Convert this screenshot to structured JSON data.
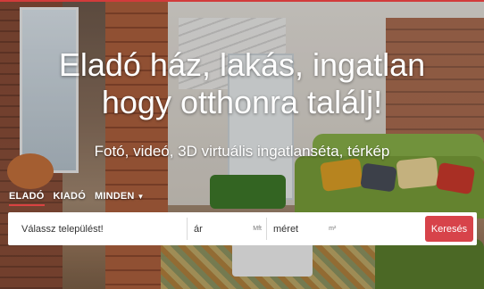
{
  "hero": {
    "headline_line1": "Eladó ház, lakás, ingatlan",
    "headline_line2": "hogy otthonra találj!",
    "subline": "Fotó, videó, 3D virtuális ingatlanséta, térkép"
  },
  "tabs": [
    {
      "label": "ELADÓ",
      "active": true
    },
    {
      "label": "KIADÓ",
      "active": false
    },
    {
      "label": "MINDEN",
      "active": false,
      "has_dropdown": true
    }
  ],
  "search": {
    "settlement_placeholder": "Válassz települést!",
    "price_label": "ár",
    "price_unit": "Mft",
    "size_label": "méret",
    "size_unit": "m²",
    "button_label": "Keresés"
  },
  "colors": {
    "accent": "#d7434a",
    "text_on_image": "#ffffff"
  }
}
